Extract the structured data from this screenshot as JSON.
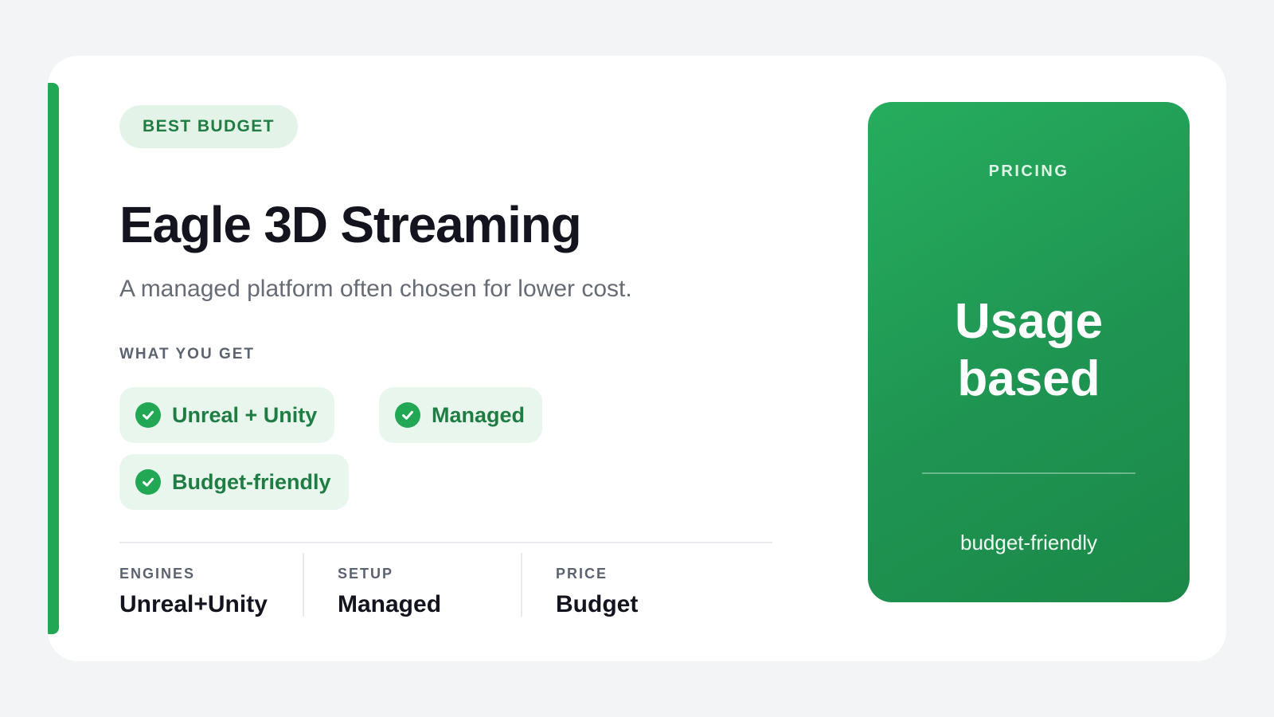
{
  "badge": "BEST BUDGET",
  "title": "Eagle 3D Streaming",
  "subtitle": "A managed platform often chosen for lower cost.",
  "features_label": "WHAT YOU GET",
  "features": [
    {
      "label": "Unreal + Unity",
      "icon": "check-circle-icon"
    },
    {
      "label": "Managed",
      "icon": "check-circle-icon"
    },
    {
      "label": "Budget-friendly",
      "icon": "check-circle-icon"
    }
  ],
  "stats": [
    {
      "label": "ENGINES",
      "value": "Unreal+Unity"
    },
    {
      "label": "SETUP",
      "value": "Managed"
    },
    {
      "label": "PRICE",
      "value": "Budget"
    }
  ],
  "pricing": {
    "label": "PRICING",
    "value_line1": "Usage",
    "value_line2": "based",
    "note": "budget-friendly"
  },
  "colors": {
    "accent": "#22a755",
    "badge_bg": "#e3f3e8",
    "pill_bg": "#e9f6ee",
    "accent_text": "#1f7d43"
  }
}
